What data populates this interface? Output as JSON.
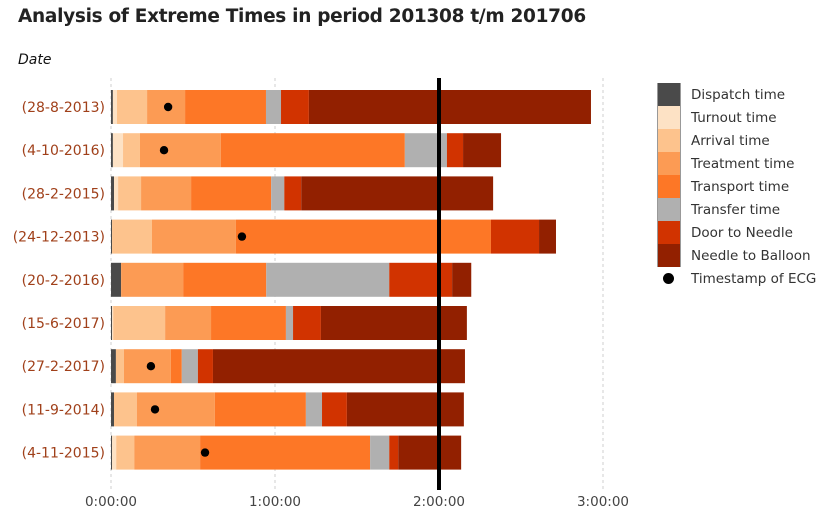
{
  "title": "Analysis of Extreme Times in period 201308 t/m 201706",
  "chart_data": {
    "type": "bar",
    "orientation": "horizontal-stacked",
    "title": "Analysis of Extreme Times in period 201308 t/m 201706",
    "ylabel": "Date",
    "xlabel": "",
    "x_unit": "minutes",
    "xlim": [
      0,
      180
    ],
    "x_ticks": [
      {
        "value": 0,
        "label": "0:00:00"
      },
      {
        "value": 60,
        "label": "1:00:00"
      },
      {
        "value": 120,
        "label": "2:00:00"
      },
      {
        "value": 180,
        "label": "3:00:00"
      }
    ],
    "reference_line": {
      "value": 120,
      "label": "2:00:00",
      "color": "#000000"
    },
    "grid": "vertical-dashed",
    "legend_position": "right",
    "categories": [
      "(28-8-2013)",
      "(4-10-2016)",
      "(28-2-2015)",
      "(24-12-2013)",
      "(20-2-2016)",
      "(15-6-2017)",
      "(27-2-2017)",
      "(11-9-2014)",
      "(4-11-2015)"
    ],
    "series": [
      {
        "name": "Dispatch time",
        "color": "#4a4a4a",
        "values": [
          0.7,
          0.7,
          1.1,
          0.4,
          3.7,
          0.4,
          1.8,
          1.1,
          0.4
        ]
      },
      {
        "name": "Turnout time",
        "color": "#fde2c5",
        "values": [
          1.5,
          3.7,
          1.5,
          0,
          0,
          0.4,
          0,
          0,
          1.5
        ]
      },
      {
        "name": "Arrival time",
        "color": "#fdc38d",
        "values": [
          11.0,
          6.2,
          8.4,
          14.6,
          0,
          19.0,
          2.9,
          8.4,
          6.6
        ]
      },
      {
        "name": "Treatment time",
        "color": "#fc9b54",
        "values": [
          13.9,
          29.6,
          18.3,
          30.7,
          22.7,
          16.8,
          17.2,
          28.5,
          24.1
        ]
      },
      {
        "name": "Transport time",
        "color": "#fd7726",
        "values": [
          29.6,
          67.3,
          29.3,
          93.3,
          30.4,
          27.4,
          4.0,
          33.3,
          62.2
        ]
      },
      {
        "name": "Transfer time",
        "color": "#b0b0b0",
        "values": [
          5.5,
          15.4,
          4.8,
          0,
          45.0,
          2.6,
          5.9,
          5.9,
          7.0
        ]
      },
      {
        "name": "Door to Needle",
        "color": "#d13300",
        "values": [
          10.2,
          5.9,
          6.2,
          17.6,
          23.0,
          10.2,
          5.5,
          9.1,
          3.3
        ]
      },
      {
        "name": "Needle to Balloon",
        "color": "#922000",
        "values": [
          103.2,
          13.9,
          70.2,
          6.2,
          7.0,
          53.4,
          92.2,
          42.8,
          23.0
        ]
      }
    ],
    "ecg_timestamps": {
      "name": "Timestamp of ECG",
      "values": [
        20.9,
        19.4,
        null,
        47.9,
        null,
        null,
        14.6,
        16.1,
        34.4
      ]
    },
    "category_label_color": "#a0401a"
  }
}
